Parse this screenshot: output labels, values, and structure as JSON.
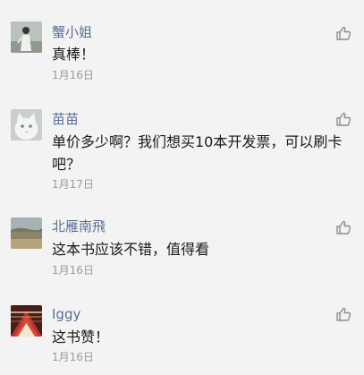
{
  "comments": [
    {
      "author": "蟹小姐",
      "content": "真棒！",
      "date": "1月16日",
      "avatar": "woman-portrait-avatar",
      "like_icon": "thumbs-up-icon"
    },
    {
      "author": "苗苗",
      "content": "单价多少啊？我们想买10本开发票，可以刷卡吧？",
      "date": "1月17日",
      "avatar": "white-cat-avatar",
      "like_icon": "thumbs-up-icon"
    },
    {
      "author": "北雁南飛",
      "content": "这本书应该不错，值得看",
      "date": "1月16日",
      "avatar": "landscape-avatar",
      "like_icon": "thumbs-up-icon"
    },
    {
      "author": "Iggy",
      "content": "这书赞！",
      "date": "1月16日",
      "avatar": "red-architecture-avatar",
      "like_icon": "thumbs-up-icon"
    }
  ],
  "colors": {
    "background": "#f3f3f3",
    "author": "#5a6e93",
    "content": "#1a1a1a",
    "date": "#9a9a9a",
    "icon": "#8c8c8c"
  }
}
